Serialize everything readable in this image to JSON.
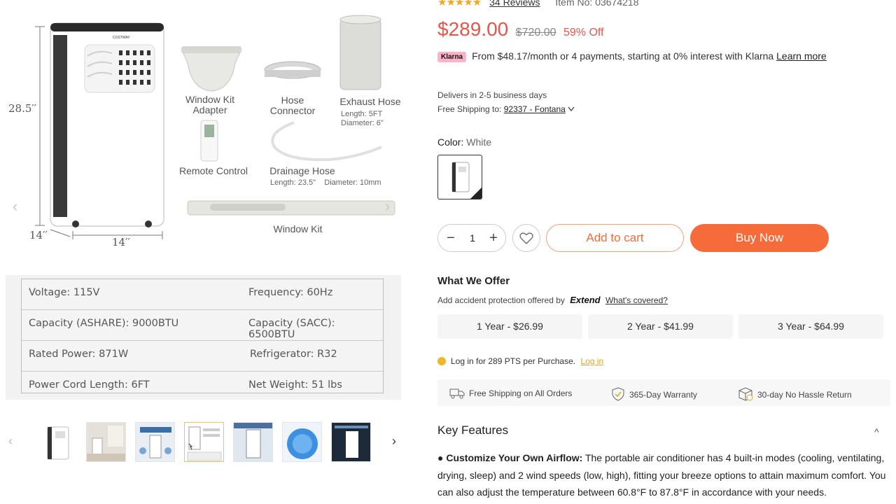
{
  "product_images": {
    "dimensions": {
      "height": "28.5′′",
      "depth": "14′′",
      "width": "14′′"
    },
    "brand_mark": "COSTWAY",
    "parts": [
      {
        "name": "Window Kit\nAdapter"
      },
      {
        "name": "Hose\nConnector"
      },
      {
        "name": "Exhaust Hose",
        "detail": "Length: 5FT\nDiameter: 6\""
      },
      {
        "name": "Remote Control"
      },
      {
        "name": "Drainage Hose",
        "detail": "Length: 23.5\"    Diameter: 10mm"
      },
      {
        "name": "Window Kit"
      }
    ],
    "specs": [
      [
        "Voltage: 115V",
        "Frequency: 60Hz"
      ],
      [
        "Capacity (ASHARE): 9000BTU",
        "Capacity (SACC): 6500BTU"
      ],
      [
        "Rated Power: 871W",
        "Refrigerator: R32"
      ],
      [
        "Power Cord Length: 6FT",
        "Net Weight: 51 lbs"
      ]
    ],
    "thumb_count": 7,
    "active_thumb": 4
  },
  "product": {
    "stars": "★★★★★",
    "reviews": "34 Reviews",
    "item_no": "Item No: 03674218",
    "price": "$289.00",
    "old_price": "$720.00",
    "discount": "59% Off",
    "klarna_badge": "Klarna",
    "klarna_text": "From $48.17/month or 4 payments, starting at 0% interest with Klarna",
    "learn_more": "Learn more",
    "delivery": "Delivers in 2-5 business days",
    "shipping_label": "Free Shipping to:",
    "zip": "92337 - Fontana",
    "color_label": "Color:",
    "color_value": "White",
    "quantity": "1",
    "add_to_cart": "Add to cart",
    "buy_now": "Buy Now"
  },
  "offer": {
    "title": "What We Offer",
    "sub": "Add accident protection offered by",
    "extend": "Extend",
    "covered": "What's covered?",
    "plans": [
      "1 Year - $26.99",
      "2 Year - $41.99",
      "3 Year - $64.99"
    ],
    "points": "Log in for 289 PTS per Purchase.",
    "login": "Log in"
  },
  "benefits": [
    "Free Shipping on All Orders",
    "365-Day Warranty",
    "30-day No Hassle Return"
  ],
  "key_features": {
    "title": "Key Features",
    "toggle": "^",
    "bullet": "●",
    "first_bold": "Customize Your Own Airflow:",
    "first_text": " The portable air conditioner has 4 built-in modes (cooling, ventilating, drying, sleep) and 2 wind speeds (low, high), fitting your breeze options to attain maximum comfort. You can also adjust the temperature between 60.8°F to 87.8°F in accordance with your needs."
  },
  "colors": {
    "accent": "#f56b3a",
    "price": "#e2574c",
    "klarna": "#ffb3c7",
    "star": "#f5a623"
  }
}
